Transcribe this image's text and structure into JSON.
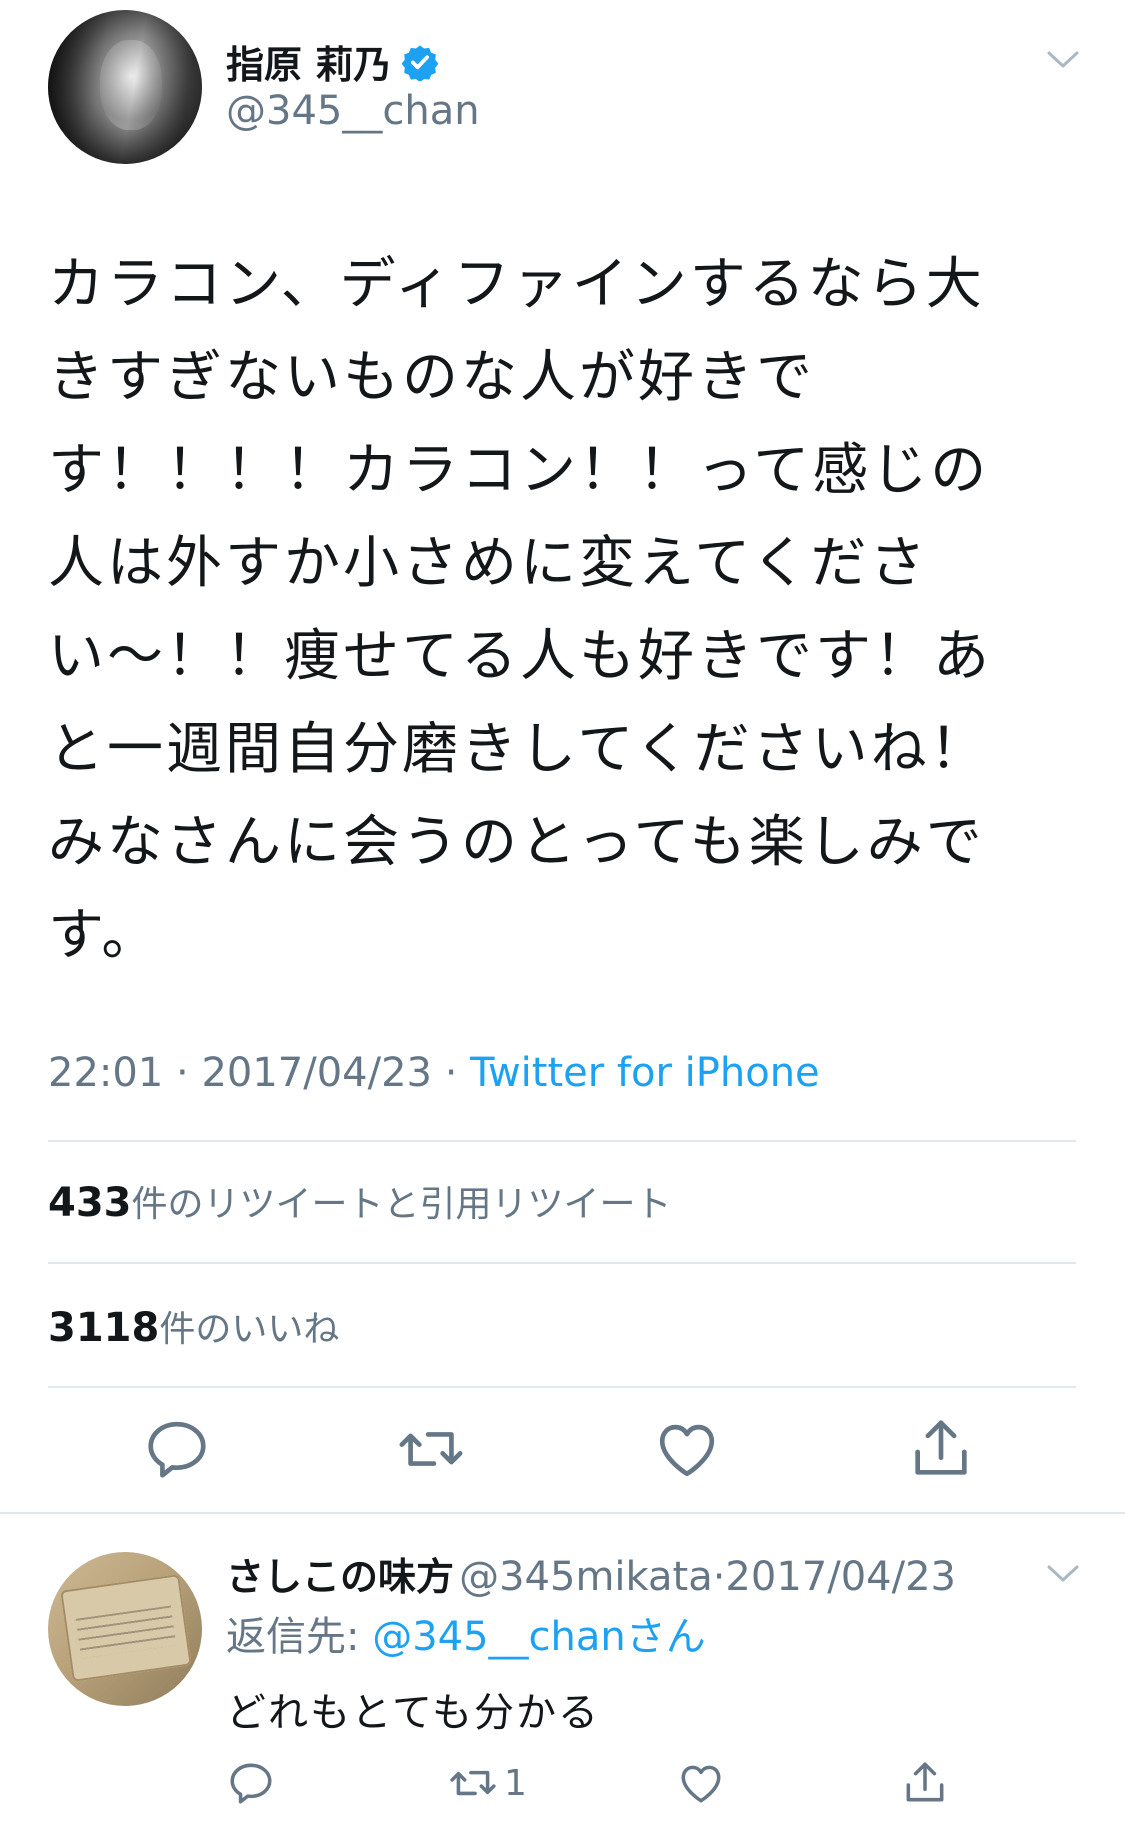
{
  "tweet": {
    "author_name": "指原 莉乃",
    "author_handle": "@345__chan",
    "body_lines": [
      "カラコン、ディファインするなら大",
      "きすぎないものな人が好きで",
      "す！！！！カラコン！！って感じの",
      "人は外すか小さめに変えてくださ",
      "い〜！！痩せてる人も好きです！あ",
      "と一週間自分磨きしてくださいね！",
      "みなさんに会うのとっても楽しみで",
      "す。"
    ],
    "time": "22:01",
    "separator": "·",
    "date": "2017/04/23",
    "source": "Twitter for iPhone",
    "retweets_count": "433",
    "retweets_label": "件のリツイートと引用リツイート",
    "likes_count": "3118",
    "likes_label": "件のいいね"
  },
  "reply": {
    "author_name": "さしこの味方",
    "author_handle": "@345mikata",
    "separator": "·",
    "date": "2017/04/23",
    "reply_prefix": "返信先: ",
    "reply_mention": "@345__chan",
    "reply_suffix": "さん",
    "text": "どれもとても分かる",
    "retweet_count": "1"
  },
  "icons": {
    "verified": "verified-badge-icon",
    "menu": "chevron-down-icon",
    "reply": "reply-icon",
    "retweet": "retweet-icon",
    "like": "heart-icon",
    "share": "share-icon"
  },
  "colors": {
    "accent": "#1da1f2",
    "secondary_text": "#657786",
    "primary_text": "#14171a",
    "divider": "#e1e8ed"
  }
}
